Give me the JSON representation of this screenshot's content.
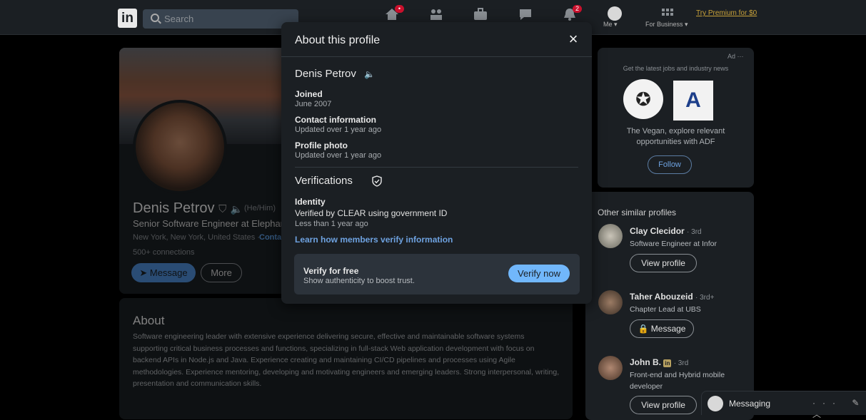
{
  "nav": {
    "logo": "in",
    "search_placeholder": "Search",
    "home_badge": "",
    "notif_badge": "2",
    "me_label": "Me ▾",
    "business_label": "For Business ▾",
    "premium_link": "Try Premium for $0"
  },
  "profile": {
    "name": "Denis Petrov",
    "pronouns": "(He/Him)",
    "headline": "Senior Software Engineer at Elephant",
    "location": "New York, New York, United States ·",
    "contact_link": "Conta",
    "connections": "500+ connections",
    "message_btn": "Message",
    "more_btn": "More"
  },
  "about": {
    "title": "About",
    "text": "Software engineering leader with extensive experience delivering secure, effective and maintainable software systems supporting critical business processes and functions, specializing in full-stack Web application development with focus on backend APIs in Node.js and Java. Experience creating and maintaining CI/CD pipelines and processes using Agile methodologies. Experience mentoring, developing and motivating engineers and emerging leaders. Strong interpersonal, writing, presentation and communication skills."
  },
  "ad": {
    "label": "Ad ···",
    "tagline": "Get the latest jobs and industry news",
    "text": "The Vegan, explore relevant opportunities with ADF",
    "follow": "Follow"
  },
  "similar": {
    "title": "Other similar profiles",
    "items": [
      {
        "name": "Clay Clecidor",
        "degree": "· 3rd",
        "headline": "Software Engineer at Infor",
        "button": "View profile"
      },
      {
        "name": "Taher Abouzeid",
        "degree": "· 3rd+",
        "headline": "Chapter Lead at UBS",
        "button": "Message"
      },
      {
        "name": "John B.",
        "degree": "· 3rd",
        "headline": "Front-end and Hybrid mobile developer",
        "button": "View profile"
      }
    ]
  },
  "messaging": {
    "label": "Messaging",
    "icons": "··· ✎ ︿"
  },
  "modal": {
    "title": "About this profile",
    "close": "×",
    "name": "Denis Petrov",
    "joined_label": "Joined",
    "joined_value": "June 2007",
    "contact_label": "Contact information",
    "contact_value": "Updated over 1 year ago",
    "photo_label": "Profile photo",
    "photo_value": "Updated over 1 year ago",
    "verifications_title": "Verifications",
    "identity_label": "Identity",
    "identity_value": "Verified by CLEAR using government ID",
    "identity_time": "Less than 1 year ago",
    "learn_link": "Learn how members verify information",
    "verify_title": "Verify for free",
    "verify_sub": "Show authenticity to boost trust.",
    "verify_btn": "Verify now"
  }
}
